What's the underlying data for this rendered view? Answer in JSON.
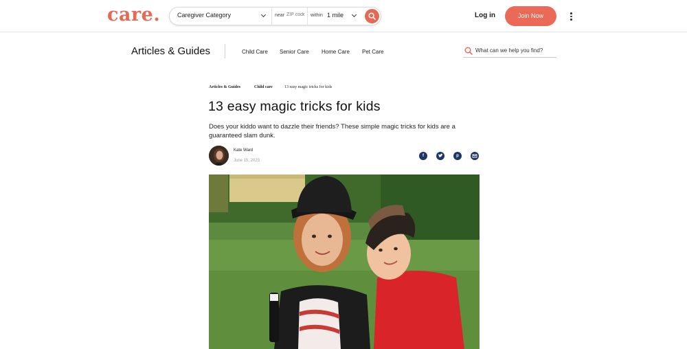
{
  "header": {
    "logo": "care.",
    "category": "Caregiver Category",
    "near_label": "near",
    "zip_placeholder": "ZIP code",
    "within_label": "within",
    "distance": "1 mile",
    "login_label": "Log in",
    "join_label": "Join Now"
  },
  "subnav": {
    "title": "Articles & Guides",
    "items": [
      "Child Care",
      "Senior Care",
      "Home Care",
      "Pet Care"
    ],
    "search_placeholder": "What can we help you find?"
  },
  "article": {
    "breadcrumbs": [
      "Articles & Guides",
      "Child care",
      "13 easy magic tricks for kids"
    ],
    "title": "13 easy magic tricks for kids",
    "dek": "Does your kiddo want to dazzle their friends? These simple magic tricks for kids are a guaranteed slam dunk.",
    "author": "Kate Ward",
    "date": "June 15, 2023",
    "share": [
      "facebook-icon",
      "twitter-icon",
      "pinterest-icon",
      "email-icon"
    ]
  },
  "colors": {
    "brand": "#e56a55",
    "join_button": "#ea6a57",
    "share_icon": "#1f3566"
  }
}
